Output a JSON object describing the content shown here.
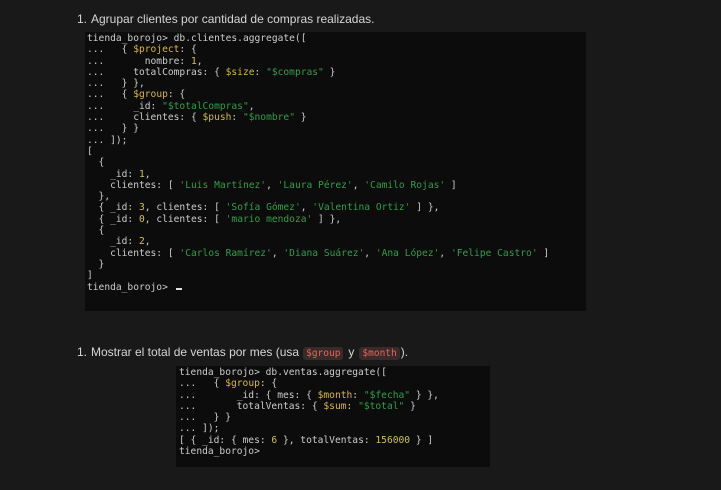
{
  "item1": {
    "number": "1.",
    "text": "Agrupar clientes por cantidad de compras realizadas."
  },
  "terminal1": {
    "lines": [
      [
        {
          "t": "tienda_borojo> db.clientes.aggregate(["
        }
      ],
      [
        {
          "t": "...   { "
        },
        {
          "t": "$project",
          "c": "k"
        },
        {
          "t": ": {"
        }
      ],
      [
        {
          "t": "...       nombre: "
        },
        {
          "t": "1",
          "c": "n"
        },
        {
          "t": ","
        }
      ],
      [
        {
          "t": "...     totalCompras: { "
        },
        {
          "t": "$size",
          "c": "k"
        },
        {
          "t": ": "
        },
        {
          "t": "\"$compras\"",
          "c": "s"
        },
        {
          "t": " }"
        }
      ],
      [
        {
          "t": "...   } },"
        }
      ],
      [
        {
          "t": "...   { "
        },
        {
          "t": "$group",
          "c": "k"
        },
        {
          "t": ": {"
        }
      ],
      [
        {
          "t": "...     _id: "
        },
        {
          "t": "\"$totalCompras\"",
          "c": "s"
        },
        {
          "t": ","
        }
      ],
      [
        {
          "t": "...     clientes: { "
        },
        {
          "t": "$push",
          "c": "k"
        },
        {
          "t": ": "
        },
        {
          "t": "\"$nombre\"",
          "c": "s"
        },
        {
          "t": " }"
        }
      ],
      [
        {
          "t": "...   } }"
        }
      ],
      [
        {
          "t": "... ]);"
        }
      ],
      [
        {
          "t": "["
        }
      ],
      [
        {
          "t": "  {"
        }
      ],
      [
        {
          "t": "    _id: "
        },
        {
          "t": "1",
          "c": "n"
        },
        {
          "t": ","
        }
      ],
      [
        {
          "t": "    clientes: [ "
        },
        {
          "t": "'Luis Martínez'",
          "c": "s"
        },
        {
          "t": ", "
        },
        {
          "t": "'Laura Pérez'",
          "c": "s"
        },
        {
          "t": ", "
        },
        {
          "t": "'Camilo Rojas'",
          "c": "s"
        },
        {
          "t": " ]"
        }
      ],
      [
        {
          "t": "  },"
        }
      ],
      [
        {
          "t": "  { _id: "
        },
        {
          "t": "3",
          "c": "n"
        },
        {
          "t": ", clientes: [ "
        },
        {
          "t": "'Sofía Gómez'",
          "c": "s"
        },
        {
          "t": ", "
        },
        {
          "t": "'Valentina Ortiz'",
          "c": "s"
        },
        {
          "t": " ] },"
        }
      ],
      [
        {
          "t": "  { _id: "
        },
        {
          "t": "0",
          "c": "n"
        },
        {
          "t": ", clientes: [ "
        },
        {
          "t": "'mario mendoza'",
          "c": "s"
        },
        {
          "t": " ] },"
        }
      ],
      [
        {
          "t": "  {"
        }
      ],
      [
        {
          "t": "    _id: "
        },
        {
          "t": "2",
          "c": "n"
        },
        {
          "t": ","
        }
      ],
      [
        {
          "t": "    clientes: [ "
        },
        {
          "t": "'Carlos Ramírez'",
          "c": "s"
        },
        {
          "t": ", "
        },
        {
          "t": "'Diana Suárez'",
          "c": "s"
        },
        {
          "t": ", "
        },
        {
          "t": "'Ana López'",
          "c": "s"
        },
        {
          "t": ", "
        },
        {
          "t": "'Felipe Castro'",
          "c": "s"
        },
        {
          "t": " ]"
        }
      ],
      [
        {
          "t": "  }"
        }
      ],
      [
        {
          "t": "]"
        }
      ],
      [
        {
          "t": "tienda_borojo> "
        }
      ]
    ]
  },
  "item2": {
    "number": "1.",
    "text_before": "Mostrar el total de ventas por mes (usa",
    "code1": "$group",
    "text_mid": "y",
    "code2": "$month",
    "text_after": ")."
  },
  "terminal2": {
    "lines": [
      [
        {
          "t": "tienda_borojo> db.ventas.aggregate(["
        }
      ],
      [
        {
          "t": "...   { "
        },
        {
          "t": "$group",
          "c": "k"
        },
        {
          "t": ": {"
        }
      ],
      [
        {
          "t": "...       _id: { mes: { "
        },
        {
          "t": "$month",
          "c": "k"
        },
        {
          "t": ": "
        },
        {
          "t": "\"$fecha\"",
          "c": "s"
        },
        {
          "t": " } },"
        }
      ],
      [
        {
          "t": "...       totalVentas: { "
        },
        {
          "t": "$sum",
          "c": "k"
        },
        {
          "t": ": "
        },
        {
          "t": "\"$total\"",
          "c": "s"
        },
        {
          "t": " }"
        }
      ],
      [
        {
          "t": "...   } }"
        }
      ],
      [
        {
          "t": "... ]);"
        }
      ],
      [
        {
          "t": "[ { _id: { mes: "
        },
        {
          "t": "6",
          "c": "n"
        },
        {
          "t": " }, totalVentas: "
        },
        {
          "t": "156000",
          "c": "n"
        },
        {
          "t": " } ]"
        }
      ],
      [
        {
          "t": "tienda_borojo>"
        }
      ]
    ]
  },
  "colors": {
    "background": "#191919",
    "terminal_bg": "#0c0c0c",
    "string": "#2f9e4a",
    "operator": "#d8b93a",
    "inline_code": "#e8645a"
  }
}
